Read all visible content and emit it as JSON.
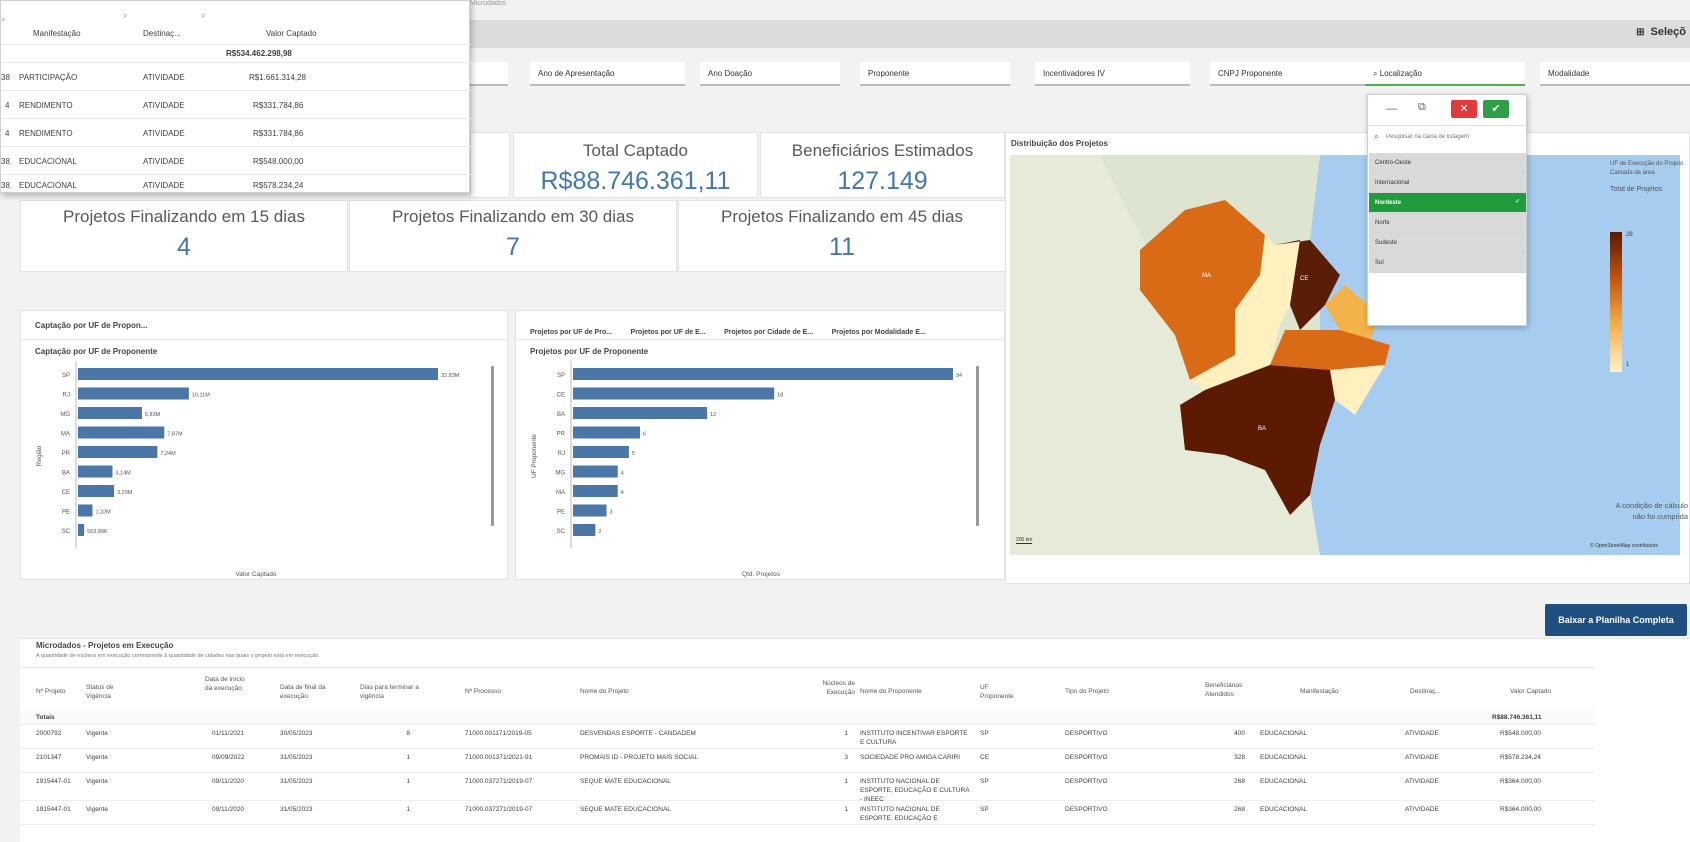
{
  "top_hint": "Microdados",
  "toolbar": {
    "selections_label": "Seleçõ"
  },
  "filters": [
    "Ano de Apresentação",
    "Ano Doação",
    "Proponente",
    "Incentivadores IV",
    "CNPJ Proponente",
    "Localização",
    "Modalidade"
  ],
  "overlay_table": {
    "headers": [
      "Manifestação",
      "Destinaç...",
      "Valor Captado"
    ],
    "total": "R$534.462.298,98",
    "rows": [
      {
        "code": "38",
        "manif": "PARTICIPAÇÃO",
        "dest": "ATIVIDADE",
        "valor": "R$1.661.314,28"
      },
      {
        "code": "4",
        "manif": "RENDIMENTO",
        "dest": "ATIVIDADE",
        "valor": "R$331.784,86"
      },
      {
        "code": "4",
        "manif": "RENDIMENTO",
        "dest": "ATIVIDADE",
        "valor": "R$331.784,86"
      },
      {
        "code": "38",
        "manif": "EDUCACIONAL",
        "dest": "ATIVIDADE",
        "valor": "R$548.000,00"
      },
      {
        "code": "38",
        "manif": "EDUCACIONAL",
        "dest": "ATIVIDADE",
        "valor": "R$578.234,24"
      }
    ]
  },
  "kpis": {
    "total_captado": {
      "label": "Total Captado",
      "value": "R$88.746.361,11"
    },
    "beneficiarios": {
      "label": "Beneficiários Estimados",
      "value": "127.149"
    },
    "fin15": {
      "label": "Projetos Finalizando em 15 dias",
      "value": "4"
    },
    "fin30": {
      "label": "Projetos Finalizando em 30 dias",
      "value": "7"
    },
    "fin45": {
      "label": "Projetos Finalizando em 45 dias",
      "value": "11"
    }
  },
  "captacao_panel": {
    "tab": "Captação por UF de Propon...",
    "title": "Captação por UF de Proponente",
    "xlabel": "Valor Captado",
    "ylabel": "Região"
  },
  "projetos_panel": {
    "tabs": [
      "Projetos por UF de Pro...",
      "Projetos por UF de E...",
      "Projetos por Cidade de E...",
      "Projetos por Modalidade E..."
    ],
    "title": "Projetos por UF de Proponente",
    "xlabel": "Qtd. Projetos",
    "ylabel": "UF Proponente"
  },
  "chart_data": [
    {
      "type": "bar",
      "orientation": "horizontal",
      "title": "Captação por UF de Proponente",
      "xlabel": "Valor Captado",
      "ylabel": "Região",
      "categories": [
        "SP",
        "RJ",
        "MG",
        "MA",
        "PR",
        "BA",
        "CE",
        "PE",
        "SC"
      ],
      "values": [
        32.83,
        10.11,
        5.83,
        7.87,
        7.24,
        3.14,
        3.29,
        1.32,
        0.56
      ],
      "data_labels": [
        "32,83M",
        "10,11M",
        "5,83M",
        "7,87M",
        "7,24M",
        "3,14M",
        "3,29M",
        "1,32M",
        "563,89K"
      ]
    },
    {
      "type": "bar",
      "orientation": "horizontal",
      "title": "Projetos por UF de Proponente",
      "xlabel": "Qtd. Projetos",
      "ylabel": "UF Proponente",
      "categories": [
        "SP",
        "CE",
        "BA",
        "PR",
        "RJ",
        "MG",
        "MA",
        "PE",
        "SC"
      ],
      "values": [
        34,
        18,
        12,
        6,
        5,
        4,
        4,
        3,
        2
      ],
      "data_labels": [
        "34",
        "18",
        "12",
        "6",
        "5",
        "4",
        "4",
        "3",
        "2"
      ]
    }
  ],
  "map_panel": {
    "title": "Distribuição dos Projetos",
    "legend_title": "UF de Execução do Projeto",
    "legend_sub": "Camada de área",
    "legend_metric": "Total de Projetos",
    "legend_max": "28",
    "legend_min": "1",
    "condition_msg": "A condição de cálculo não foi cumprida",
    "scale": "200 km",
    "attribution": "© OpenStreetMap contributors"
  },
  "region_dropdown": {
    "search_placeholder": "Pesquisar na caixa de listagem",
    "items": [
      "Centro-Oeste",
      "Internacional",
      "Nordeste",
      "Norte",
      "Sudeste",
      "Sul"
    ],
    "selected": "Nordeste"
  },
  "download_button": "Baixar a Planilha Completa",
  "microdados": {
    "title": "Microdados - Projetos em Execução",
    "subtitle": "A quantidade de núcleos em execução corresponde à quantidade de cidades nas quais o projeto está em execução.",
    "headers": [
      "Nº Projeto",
      "Status de Vigência",
      "Data de início da execução",
      "Data de final da execução",
      "Dias para terminar a vigência",
      "Nº Processo",
      "Nome do Projeto",
      "Núcleos de Execução",
      "Nome do Proponente",
      "UF Proponente",
      "Tipo do Projeto",
      "Beneficiários Atendidos",
      "Manifestação",
      "Destinaç...",
      "Valor Captado"
    ],
    "totals_label": "Totais",
    "total_value": "R$88.746.361,11",
    "rows": [
      [
        "2000792",
        "Vigente",
        "01/11/2021",
        "30/05/2023",
        "8",
        "71000.001171/2019-05",
        "DESVENDAS ESPORTE - CANDADEM",
        "1",
        "INSTITUTO INCENTIVAR ESPORTE E CULTURA",
        "SP",
        "DESPORTIVO",
        "400",
        "EDUCACIONAL",
        "ATIVIDADE",
        "R$548.000,00"
      ],
      [
        "2101347",
        "Vigente",
        "09/09/2022",
        "31/05/2023",
        "1",
        "71000.001371/2021-91",
        "PROMAIS ID - PROJETO MAIS SOCIAL",
        "3",
        "SOCIEDADE PRO AMIGA CARIRI",
        "CE",
        "DESPORTIVO",
        "328",
        "EDUCACIONAL",
        "ATIVIDADE",
        "R$578.234,24"
      ],
      [
        "1915447-01",
        "Vigente",
        "09/11/2020",
        "31/05/2023",
        "1",
        "71000.037271/2019-07",
        "SEQUE MATE EDUCACIONAL",
        "1",
        "INSTITUTO NACIONAL DE ESPORTE, EDUCAÇÃO E CULTURA - INEEC",
        "SP",
        "DESPORTIVO",
        "268",
        "EDUCACIONAL",
        "ATIVIDADE",
        "R$364.000,00"
      ],
      [
        "1915447-01",
        "Vigente",
        "09/11/2020",
        "31/05/2023",
        "1",
        "71000.037271/2019-07",
        "SEQUE MATE EDUCACIONAL",
        "1",
        "INSTITUTO NACIONAL DE ESPORTE, EDUCAÇÃO E",
        "SP",
        "DESPORTIVO",
        "268",
        "EDUCACIONAL",
        "ATIVIDADE",
        "R$364.000,00"
      ]
    ]
  }
}
